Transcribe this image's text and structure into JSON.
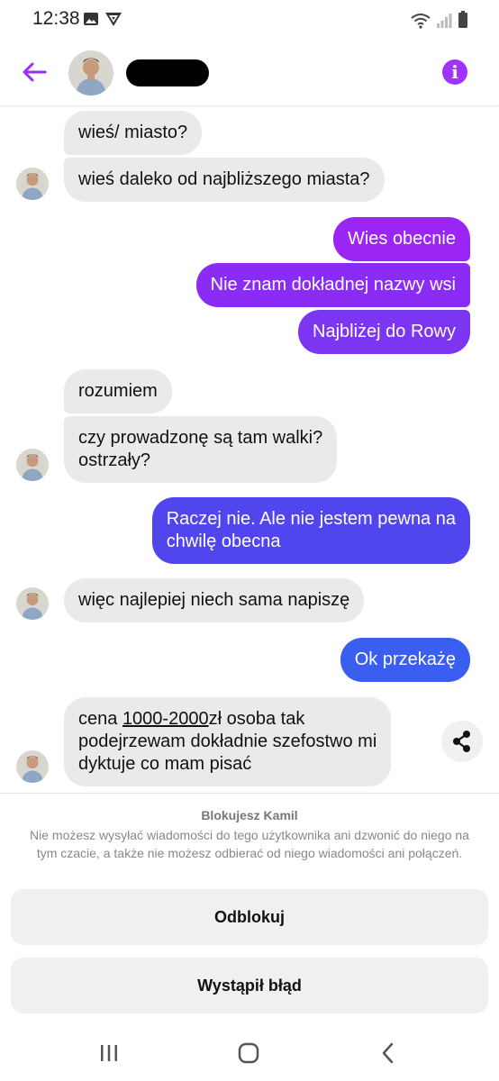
{
  "status_bar": {
    "time": "12:38"
  },
  "header": {
    "back_icon": "arrow-left-icon",
    "info_icon": "info-icon",
    "accent_color": "#a033ff"
  },
  "messages": [
    {
      "direction": "incoming",
      "text": "wieś/ miasto?"
    },
    {
      "direction": "incoming",
      "text": "wieś daleko od najbliższego miasta?"
    },
    {
      "direction": "outgoing",
      "text": "Wies obecnie",
      "color": "#9b25f5"
    },
    {
      "direction": "outgoing",
      "text": "Nie znam dokładnej nazwy wsi",
      "color": "#8a2cf6"
    },
    {
      "direction": "outgoing",
      "text": "Najbliżej do Rowy",
      "color": "#7c36f2"
    },
    {
      "direction": "incoming",
      "text": "rozumiem"
    },
    {
      "direction": "incoming",
      "lines": [
        "czy prowadzonę są tam walki?",
        "ostrzały?"
      ]
    },
    {
      "direction": "outgoing",
      "lines": [
        "Raczej nie. Ale nie jestem pewna na",
        "chwilę obecna"
      ],
      "color": "#5145ee"
    },
    {
      "direction": "incoming",
      "text": "więc najlepiej niech sama napiszę"
    },
    {
      "direction": "outgoing",
      "text": "Ok przekażę",
      "color": "#3a5ef0"
    },
    {
      "direction": "incoming",
      "lines_parts": {
        "line1_before": "cena ",
        "line1_link": "1000-2000",
        "line1_after": "zł osoba tak",
        "line2": "podejrzewam dokładnie szefostwo mi",
        "line3": "dyktuje co mam pisać"
      }
    }
  ],
  "share_icon": "share-icon",
  "block_panel": {
    "title": "Blokujesz Kamil",
    "description": "Nie możesz wysyłać wiadomości do tego użytkownika ani dzwonić do niego na tym czacie, a także nie możesz odbierać od niego wiadomości ani połączeń.",
    "unblock_label": "Odblokuj",
    "error_label": "Wystąpił błąd"
  },
  "nav_bar": {
    "recents_icon": "recents-icon",
    "home_icon": "home-icon",
    "back_icon": "back-chevron-icon"
  }
}
